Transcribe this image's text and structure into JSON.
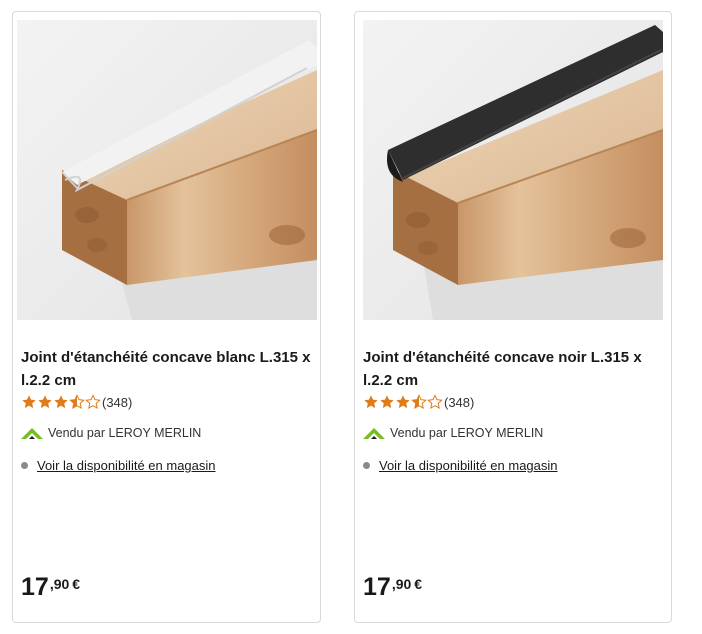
{
  "products": [
    {
      "title": "Joint d'étanchéité concave blanc L.315 x l.2.2 cm",
      "rating": 3.5,
      "reviews": "(348)",
      "seller": "Vendu par LEROY MERLIN",
      "availability_link": "Voir la disponibilité en magasin",
      "price_int": "17",
      "price_dec": ",90",
      "currency": "€",
      "seal_color": "#f2f2f2"
    },
    {
      "title": "Joint d'étanchéité concave noir L.315 x l.2.2 cm",
      "rating": 3.5,
      "reviews": "(348)",
      "seller": "Vendu par LEROY MERLIN",
      "availability_link": "Voir la disponibilité en magasin",
      "price_int": "17",
      "price_dec": ",90",
      "currency": "€",
      "seal_color": "#2e2e2e"
    }
  ],
  "colors": {
    "star": "#e07b1a",
    "brand_green": "#78be20"
  }
}
